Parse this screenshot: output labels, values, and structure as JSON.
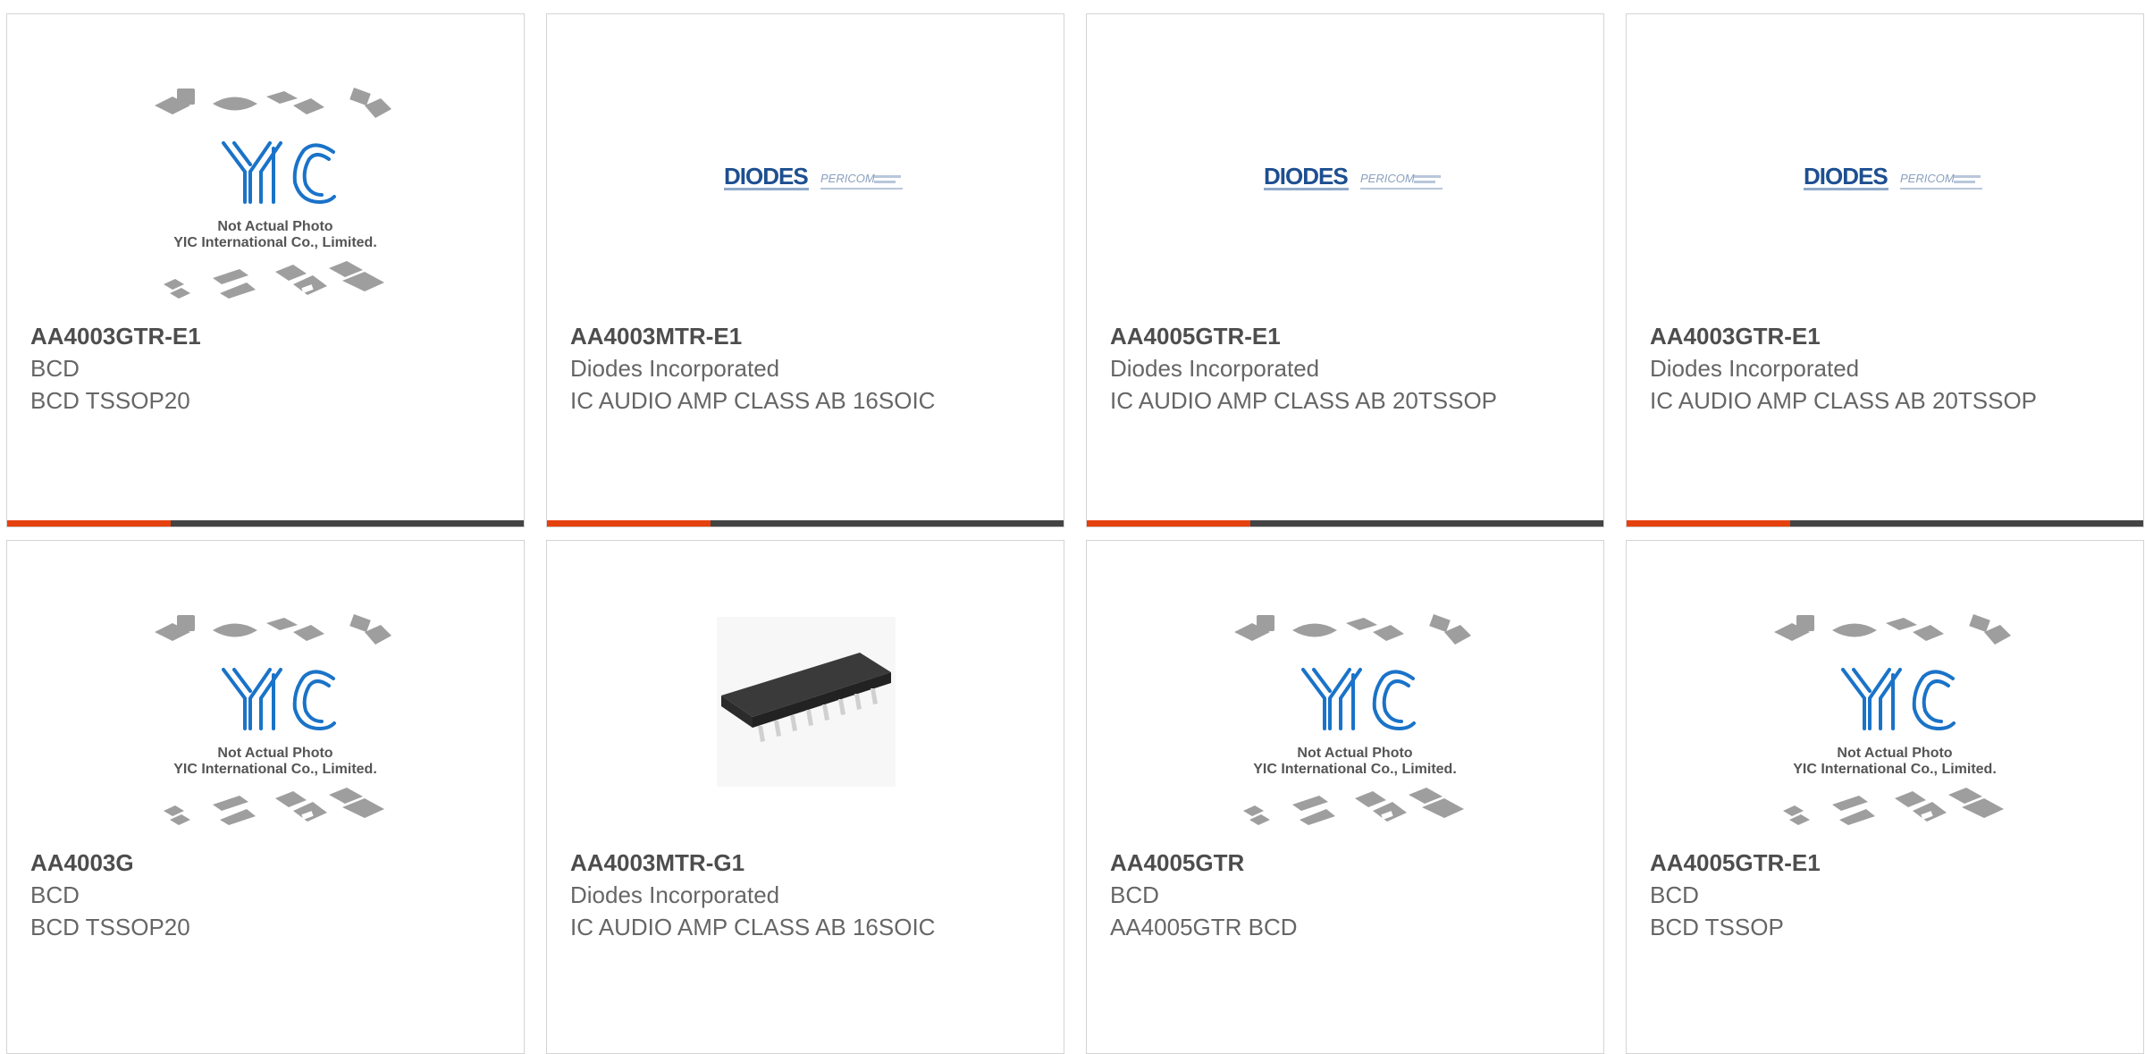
{
  "colors": {
    "accent": "#e5410f",
    "bar": "#444444",
    "yic_blue": "#1a73c8",
    "diodes_blue": "#1d4f91"
  },
  "products": [
    {
      "part": "AA4003GTR-E1",
      "manufacturer": "BCD",
      "description": "BCD TSSOP20",
      "image": "yic-placeholder"
    },
    {
      "part": "AA4003MTR-E1",
      "manufacturer": "Diodes Incorporated",
      "description": "IC AUDIO AMP CLASS AB 16SOIC",
      "image": "diodes-logo"
    },
    {
      "part": "AA4005GTR-E1",
      "manufacturer": "Diodes Incorporated",
      "description": "IC AUDIO AMP CLASS AB 20TSSOP",
      "image": "diodes-logo"
    },
    {
      "part": "AA4003GTR-E1",
      "manufacturer": "Diodes Incorporated",
      "description": "IC AUDIO AMP CLASS AB 20TSSOP",
      "image": "diodes-logo"
    },
    {
      "part": "AA4003G",
      "manufacturer": "BCD",
      "description": "BCD TSSOP20",
      "image": "yic-placeholder"
    },
    {
      "part": "AA4003MTR-G1",
      "manufacturer": "Diodes Incorporated",
      "description": "IC AUDIO AMP CLASS AB 16SOIC",
      "image": "soic-chip-photo"
    },
    {
      "part": "AA4005GTR",
      "manufacturer": "BCD",
      "description": "AA4005GTR BCD",
      "image": "yic-placeholder"
    },
    {
      "part": "AA4005GTR-E1",
      "manufacturer": "BCD",
      "description": "BCD TSSOP",
      "image": "yic-placeholder"
    }
  ],
  "placeholder": {
    "brand": "YIC",
    "line1": "Not Actual Photo",
    "line2": "YIC International Co., Limited."
  },
  "diodes_logo": {
    "brand": "DIODES",
    "sub": "PERICOM"
  }
}
